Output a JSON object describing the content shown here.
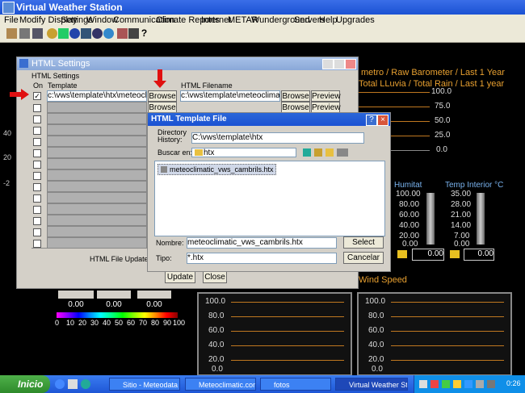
{
  "app": {
    "title": "Virtual Weather Station"
  },
  "menu": [
    "File",
    "Modify Display",
    "Settings",
    "Window",
    "Communication",
    "Climate Reports",
    "Internet",
    "METAR",
    "Wunderground",
    "Servers",
    "Help",
    "Upgrades"
  ],
  "background": {
    "panel_title_1": "metro / Raw Barometer /  Last 1 Year",
    "panel_title_2": "Total LLuvia / Total Rain / Last 1 year",
    "scale_1": [
      "100.0",
      "75.0",
      "50.0",
      "25.0",
      "0.0"
    ],
    "humitat_label": "Humitat",
    "humitat_scale": [
      "100.00",
      "80.00",
      "60.00",
      "40.00",
      "20.00",
      "0.00"
    ],
    "humitat_value": "0.00",
    "temp_label": "Temp Interior °C",
    "temp_scale": [
      "35.00",
      "28.00",
      "21.00",
      "14.00",
      "7.00",
      "0.00"
    ],
    "temp_value": "0.00",
    "wind_label": "Wind Speed",
    "bottom_scale": [
      "100.0",
      "80.0",
      "60.0",
      "40.0",
      "20.0",
      "0.0"
    ],
    "left_values": [
      "0.00",
      "0.00",
      "0.00"
    ],
    "left_marks": [
      "40",
      "20",
      "-2"
    ],
    "color_scale": [
      "0",
      "10",
      "20",
      "30",
      "40",
      "50",
      "60",
      "70",
      "80",
      "90",
      "100"
    ]
  },
  "html_settings": {
    "title": "HTML Settings",
    "group_label": "HTML Settings",
    "col_on": "On",
    "col_template": "Template",
    "col_filename": "HTML Filename",
    "row1_template": "c:\\vws\\template\\htx\\meteoclimatic_",
    "row1_filename": "c:\\vws\\template\\meteoclimatic_vws",
    "browse": "Browse",
    "preview": "Preview",
    "update_time_label": "HTML File Update Time",
    "update_button": "Update",
    "close_button": "Close"
  },
  "file_dialog": {
    "title": "HTML Template File",
    "dir_history_label": "Directory History:",
    "dir_history_value": "C:\\vws\\template\\htx",
    "lookin_label": "Buscar en:",
    "lookin_value": "htx",
    "file_item": "meteoclimatic_vws_cambrils.htx",
    "name_label": "Nombre:",
    "name_value": "meteoclimatic_vws_cambrils.htx",
    "type_label": "Tipo:",
    "type_value": "*.htx",
    "select_button": "Select",
    "cancel_button": "Cancelar"
  },
  "taskbar": {
    "start": "Inicio",
    "tasks": [
      "Sitio - Meteodata",
      "Meteoclimatic.com...",
      "fotos",
      "Virtual Weather St..."
    ],
    "clock": "0:26"
  },
  "colors": {
    "accent_orange": "#e8a030",
    "arrow_red": "#e01010",
    "xp_blue": "#1b52d3"
  }
}
